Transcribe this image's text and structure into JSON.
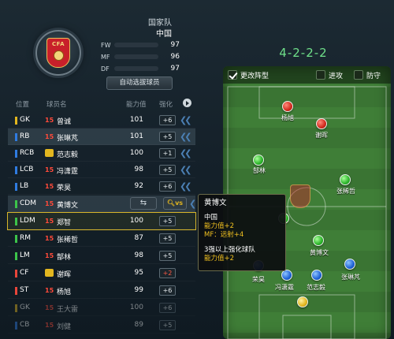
{
  "team": {
    "kind": "国家队",
    "name": "中国",
    "badge_text": "CFA",
    "stats": [
      {
        "label": "FW",
        "value": "97",
        "fill": 0.97,
        "color": "#e8463a"
      },
      {
        "label": "MF",
        "value": "96",
        "fill": 0.96,
        "color": "#3cc44a"
      },
      {
        "label": "DF",
        "value": "97",
        "fill": 0.97,
        "color": "#2f7be0"
      }
    ],
    "auto_select_label": "自动选拔球员"
  },
  "list": {
    "headers": {
      "pos": "位置",
      "name": "球员名",
      "rating": "能力值",
      "strength": "强化"
    },
    "players": [
      {
        "pos": "GK",
        "pos_color": "#e2b61f",
        "num": "15",
        "name": "曾诚",
        "rating": "101",
        "str": "+6",
        "str_color": "normal"
      },
      {
        "pos": "RB",
        "pos_color": "#2f7be0",
        "num": "15",
        "name": "张琳芃",
        "rating": "101",
        "str": "+5",
        "str_color": "normal"
      },
      {
        "pos": "RCB",
        "pos_color": "#2f7be0",
        "num": "",
        "name": "范志毅",
        "rating": "100",
        "str": "+1",
        "str_color": "normal"
      },
      {
        "pos": "LCB",
        "pos_color": "#2f7be0",
        "num": "15",
        "name": "冯潇霆",
        "rating": "98",
        "str": "+5",
        "str_color": "normal"
      },
      {
        "pos": "LB",
        "pos_color": "#2f7be0",
        "num": "15",
        "name": "荣昊",
        "rating": "92",
        "str": "+6",
        "str_color": "normal"
      },
      {
        "pos": "CDM",
        "pos_color": "#3cc44a",
        "num": "15",
        "name": "黄博文",
        "rating": "",
        "str": "",
        "str_color": "normal"
      },
      {
        "pos": "LDM",
        "pos_color": "#3cc44a",
        "num": "15",
        "name": "郑智",
        "rating": "100",
        "str": "+5",
        "str_color": "normal"
      },
      {
        "pos": "RM",
        "pos_color": "#3cc44a",
        "num": "15",
        "name": "张稀哲",
        "rating": "87",
        "str": "+5",
        "str_color": "normal"
      },
      {
        "pos": "LM",
        "pos_color": "#3cc44a",
        "num": "15",
        "name": "郜林",
        "rating": "98",
        "str": "+5",
        "str_color": "normal"
      },
      {
        "pos": "CF",
        "pos_color": "#e8463a",
        "num": "",
        "name": "谢晖",
        "rating": "95",
        "str": "+2",
        "str_color": "red"
      },
      {
        "pos": "ST",
        "pos_color": "#e8463a",
        "num": "15",
        "name": "杨旭",
        "rating": "99",
        "str": "+6",
        "str_color": "normal"
      },
      {
        "pos": "GK",
        "pos_color": "#e2b61f",
        "num": "15",
        "name": "王大雷",
        "rating": "100",
        "str": "+6",
        "str_color": "normal"
      },
      {
        "pos": "CB",
        "pos_color": "#2f7be0",
        "num": "15",
        "name": "刘健",
        "rating": "89",
        "str": "+5",
        "str_color": "normal"
      }
    ],
    "swap_icon": "⇆",
    "vs_label": "vs"
  },
  "formation": {
    "name": "4-2-2-2",
    "options": [
      {
        "label": "更改阵型",
        "checked": true
      },
      {
        "label": "进攻",
        "checked": false
      },
      {
        "label": "防守",
        "checked": false
      }
    ],
    "pitch_players": [
      {
        "name": "杨旭",
        "color": "red"
      },
      {
        "name": "谢晖",
        "color": "red"
      },
      {
        "name": "郜林",
        "color": "green"
      },
      {
        "name": "张稀哲",
        "color": "green"
      },
      {
        "name": "",
        "color": "green"
      },
      {
        "name": "黄博文",
        "color": "green"
      },
      {
        "name": "荣昊",
        "color": "blue"
      },
      {
        "name": "冯潇霆",
        "color": "blue"
      },
      {
        "name": "范志毅",
        "color": "blue"
      },
      {
        "name": "张琳芃",
        "color": "blue"
      },
      {
        "name": "",
        "color": "yellow"
      }
    ]
  },
  "tooltip": {
    "title": "黄博文",
    "country": "中国",
    "rating_bonus": "能力值+2",
    "mf_bonus": "MF：远射+4",
    "team_condition": "3强以上强化球队",
    "team_bonus": "能力值+2"
  }
}
